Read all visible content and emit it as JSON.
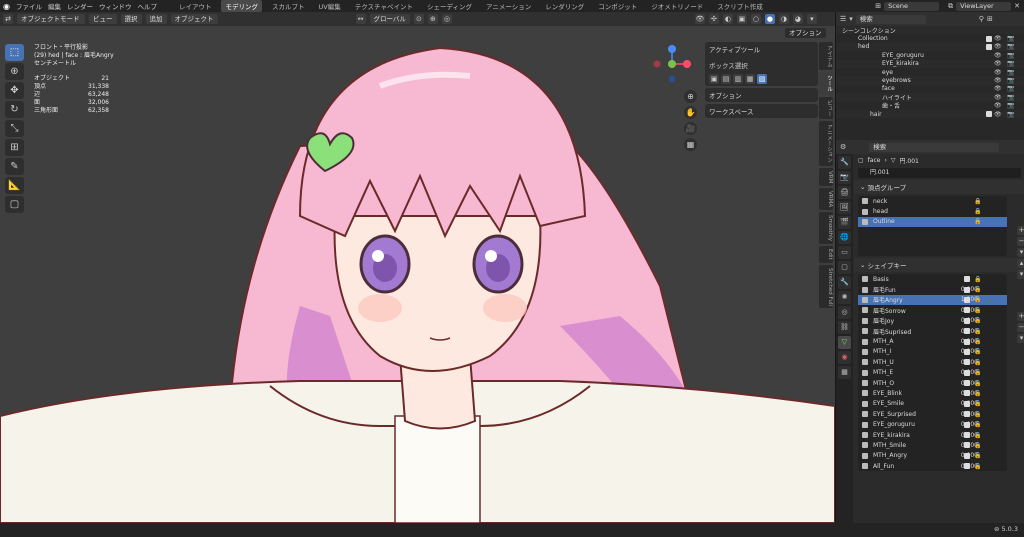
{
  "topbar": {
    "menus": [
      "ファイル",
      "編集",
      "レンダー",
      "ウィンドウ",
      "ヘルプ"
    ],
    "workspaces": [
      "レイアウト",
      "モデリング",
      "スカルプト",
      "UV編集",
      "テクスチャペイント",
      "シェーディング",
      "アニメーション",
      "レンダリング",
      "コンポジット",
      "ジオメトリノード",
      "スクリプト作成"
    ],
    "active_workspace": "モデリング",
    "scene": "Scene",
    "view_layer": "ViewLayer"
  },
  "viewport_header": {
    "mode": "オブジェクトモード",
    "menus": [
      "ビュー",
      "選択",
      "追加",
      "オブジェクト"
    ],
    "transform_orientation": "グローバル",
    "options": "オプション"
  },
  "overlay_stats": {
    "view": "フロント・平行投影",
    "context": "(29) hed | face : 眉毛Angry",
    "unit": "センチメートル",
    "rows": [
      {
        "label": "オブジェクト",
        "value": "21"
      },
      {
        "label": "頂点",
        "value": "31,338"
      },
      {
        "label": "辺",
        "value": "63,248"
      },
      {
        "label": "面",
        "value": "32,006"
      },
      {
        "label": "三角形面",
        "value": "62,358"
      }
    ]
  },
  "npanel": {
    "active_tool": "アクティブツール",
    "box_select": "ボックス選択",
    "options": "オプション",
    "workspace": "ワークスペース"
  },
  "side_tabs": [
    "アイテム",
    "ツール",
    "ビュー",
    "アニメーション",
    "VRM",
    "VRMA",
    "Smoothly",
    "Edit",
    "Stretched Full"
  ],
  "outliner": {
    "search_placeholder": "検索",
    "rows": [
      {
        "name": "シーンコレクション",
        "indent": 0
      },
      {
        "name": "Collection",
        "indent": 1
      },
      {
        "name": "hed",
        "indent": 1
      },
      {
        "name": "EYE_goruguru",
        "indent": 2
      },
      {
        "name": "EYE_kirakira",
        "indent": 2
      },
      {
        "name": "eye",
        "indent": 2
      },
      {
        "name": "eyebrows",
        "indent": 2
      },
      {
        "name": "face",
        "indent": 2
      },
      {
        "name": "ハイライト",
        "indent": 2
      },
      {
        "name": "歯・舌",
        "indent": 2
      },
      {
        "name": "hair",
        "indent": 1
      }
    ]
  },
  "properties": {
    "search_placeholder": "検索",
    "breadcrumb_object": "face",
    "breadcrumb_mesh": "円.001",
    "mesh_name": "円.001",
    "vertex_groups_title": "頂点グループ",
    "vertex_groups": [
      {
        "name": "neck",
        "selected": false
      },
      {
        "name": "head",
        "selected": false
      },
      {
        "name": "Outline",
        "selected": true
      }
    ],
    "shape_keys_title": "シェイプキー",
    "shape_keys": [
      {
        "name": "Basis",
        "value": "",
        "selected": false
      },
      {
        "name": "眉毛Fun",
        "value": "0.000",
        "selected": false
      },
      {
        "name": "眉毛Angry",
        "value": "1.000",
        "selected": true
      },
      {
        "name": "眉毛Sorrow",
        "value": "0.000",
        "selected": false
      },
      {
        "name": "眉毛Joy",
        "value": "0.000",
        "selected": false
      },
      {
        "name": "眉毛Suprised",
        "value": "0.000",
        "selected": false
      },
      {
        "name": "MTH_A",
        "value": "0.000",
        "selected": false
      },
      {
        "name": "MTH_I",
        "value": "0.000",
        "selected": false
      },
      {
        "name": "MTH_U",
        "value": "0.000",
        "selected": false
      },
      {
        "name": "MTH_E",
        "value": "0.000",
        "selected": false
      },
      {
        "name": "MTH_O",
        "value": "0.000",
        "selected": false
      },
      {
        "name": "EYE_Blink",
        "value": "0.000",
        "selected": false
      },
      {
        "name": "EYE_Smile",
        "value": "0.000",
        "selected": false
      },
      {
        "name": "EYE_Surprised",
        "value": "0.000",
        "selected": false
      },
      {
        "name": "EYE_goruguru",
        "value": "0.000",
        "selected": false
      },
      {
        "name": "EYE_kirakira",
        "value": "0.000",
        "selected": false
      },
      {
        "name": "MTH_Smile",
        "value": "0.000",
        "selected": false
      },
      {
        "name": "MTH_Angry",
        "value": "0.000",
        "selected": false
      },
      {
        "name": "All_Fun",
        "value": "0.000",
        "selected": false
      }
    ]
  },
  "status": {
    "version": "5.0.3"
  },
  "colors": {
    "accent": "#4772b3",
    "hair": "#f7b8d2",
    "hair_shadow": "#d98fcf",
    "skin": "#fde9e0",
    "hoodie": "#f6f3ea",
    "outline": "#6b2a2a",
    "eye": "#a27ad1",
    "clip": "#8be07a"
  }
}
